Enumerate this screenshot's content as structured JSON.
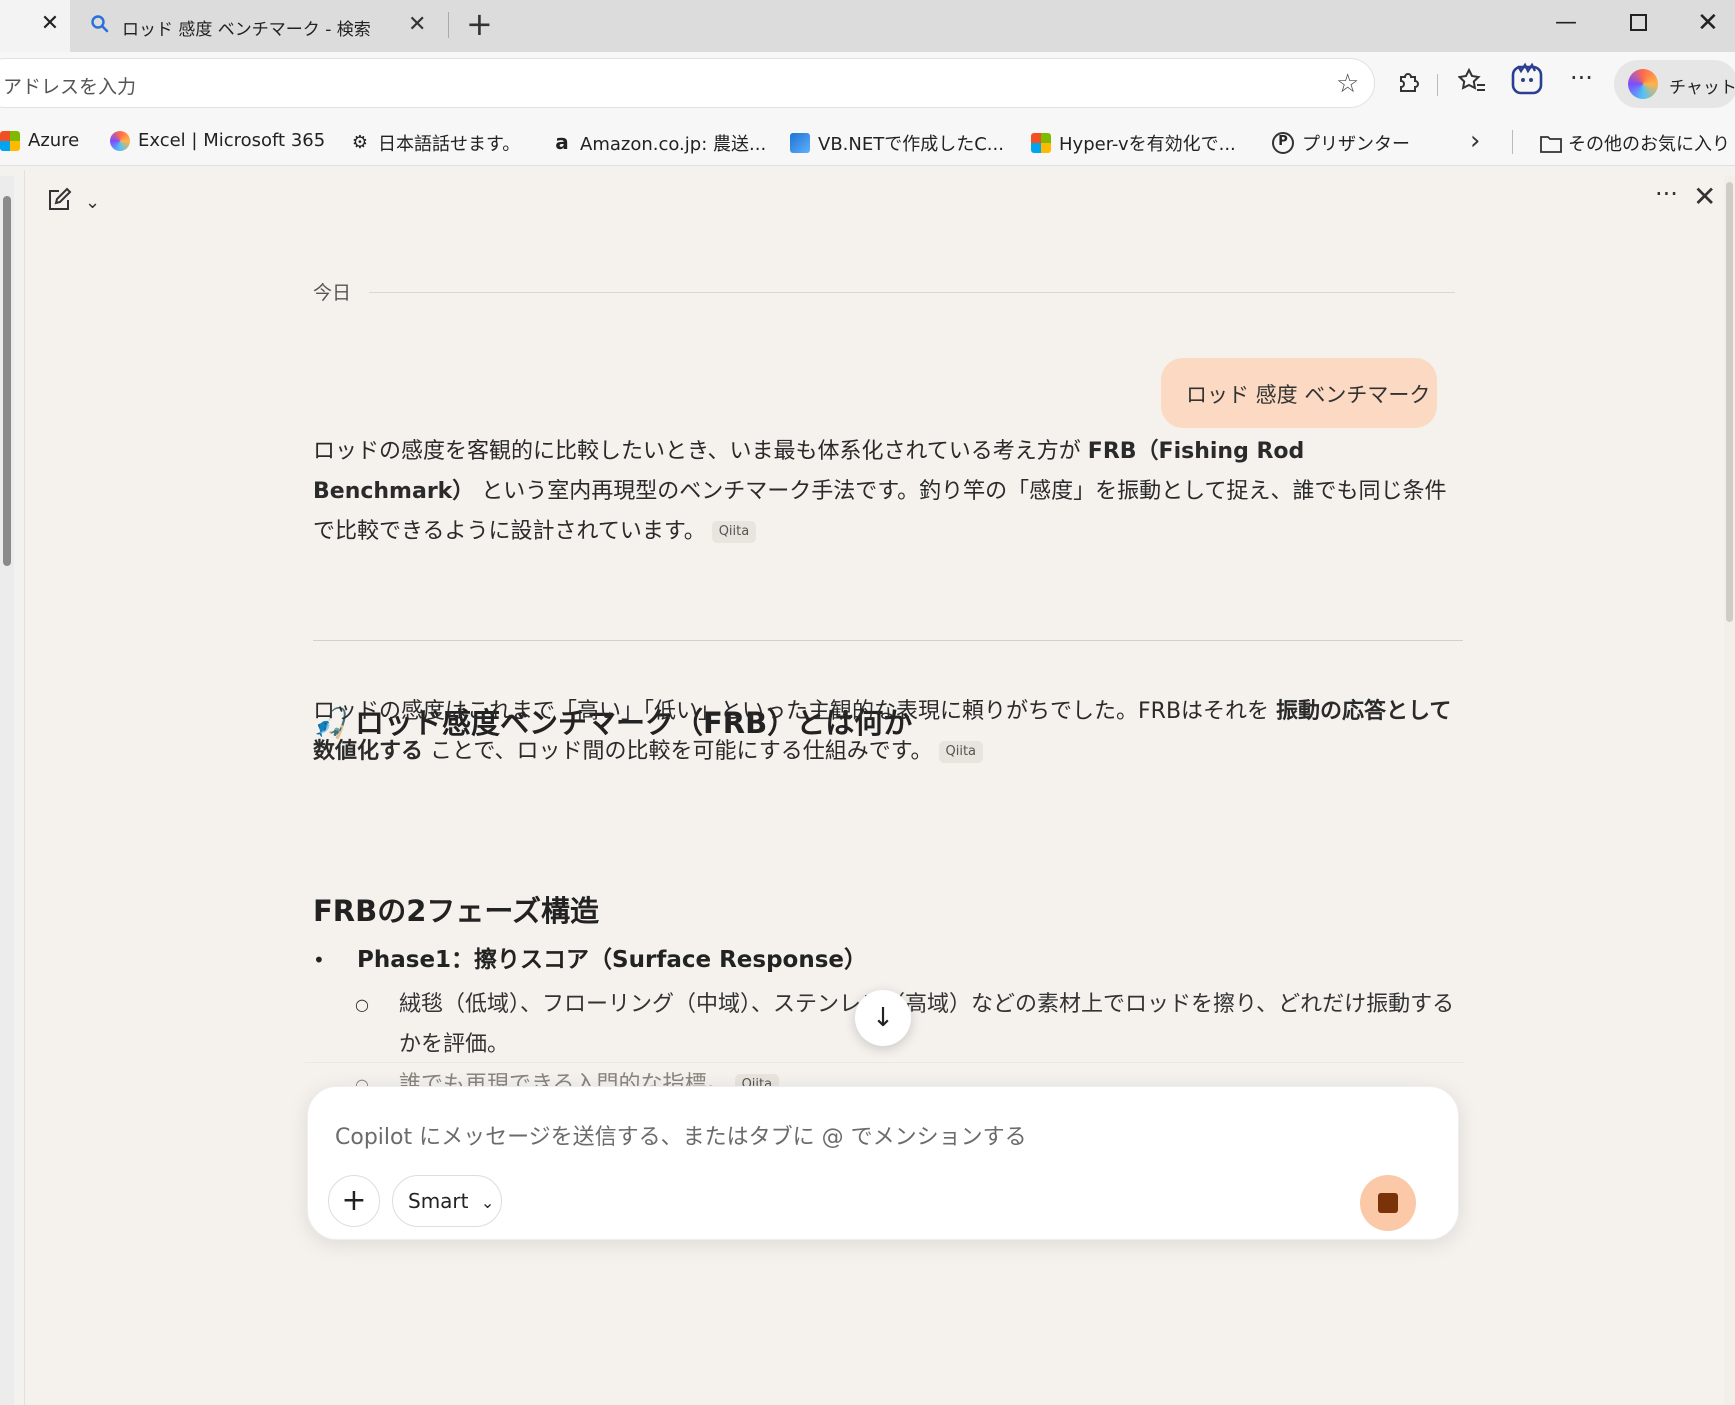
{
  "browser": {
    "tab_active_close": "✕",
    "tab": {
      "title": "ロッド 感度 ベンチマーク - 検索",
      "close": "✕"
    },
    "new_tab": "+",
    "window": {
      "minimize": "—",
      "close": "✕"
    }
  },
  "address_bar": {
    "placeholder": "アドレスを入力"
  },
  "toolbar": {
    "copilot_label": "チャット",
    "more": "···"
  },
  "bookmarks": [
    {
      "label": "Azure",
      "icon": "azure-icon"
    },
    {
      "label": "Excel | Microsoft 365",
      "icon": "copilot-icon"
    },
    {
      "label": "日本語話せます。",
      "icon": "chatgpt-icon"
    },
    {
      "label": "Amazon.co.jp: 農送...",
      "icon": "amazon-icon"
    },
    {
      "label": "VB.NETで作成したC...",
      "icon": "vbnet-icon"
    },
    {
      "label": "Hyper-vを有効化で...",
      "icon": "microsoft-icon"
    },
    {
      "label": "プリザンター",
      "icon": "pleasanter-icon"
    }
  ],
  "bookmarks_other": "その他のお気に入り",
  "copilot": {
    "today_label": "今日",
    "user_message": "ロッド 感度 ベンチマーク",
    "answer": {
      "intro_1": "ロッドの感度を客観的に比較したいとき、いま最も体系化されている考え方が ",
      "intro_bold_1": "FRB（Fishing Rod Benchmark）",
      "intro_2": " という室内再現型のベンチマーク手法です。釣り竿の「感度」を振動として捉え、誰でも同じ条件で比較できるように設計されています。",
      "cite": "Qiita",
      "heading_1": "ロッド感度ベンチマーク（FRB）とは何か",
      "heading_1_emoji": "🎣",
      "p2_1": "ロッドの感度はこれまで「高い」「低い」といった主観的な表現に頼りがちでした。FRBはそれを ",
      "p2_bold": "振動の応答として数値化する",
      "p2_2": " ことで、ロッド間の比較を可能にする仕組みです。",
      "heading_2": "FRBの2フェーズ構造",
      "bullet_1": "Phase1：擦りスコア（Surface Response）",
      "sub_1": "絨毯（低域）、フローリング（中域）、ステンレス（高域）などの素材上でロッドを擦り、どれだけ振動するかを評価。",
      "sub_2": "誰でも再現できる入門的な指標。"
    },
    "composer_placeholder": "Copilot にメッセージを送信する、またはタブに @ でメンションする",
    "smart_label": "Smart"
  }
}
